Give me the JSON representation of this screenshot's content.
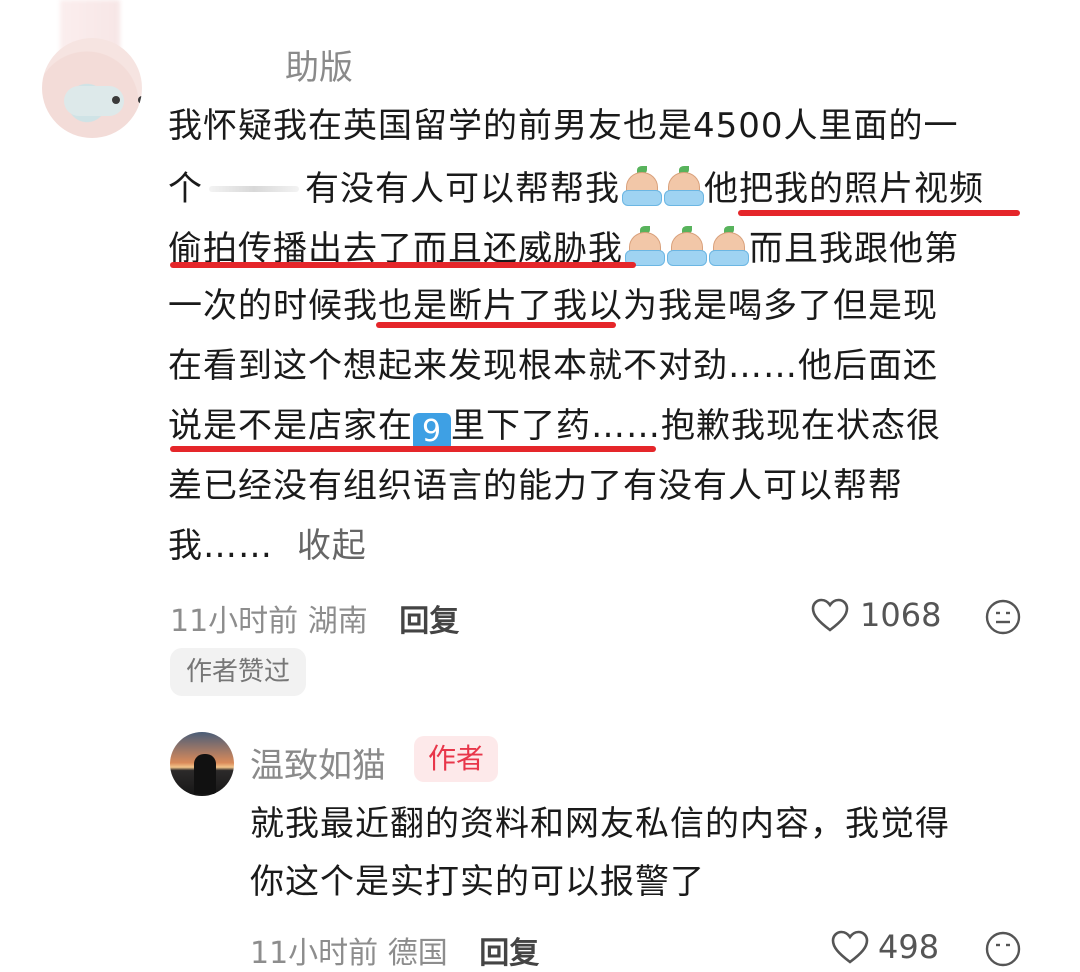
{
  "comment": {
    "username_visible": "助版",
    "lines": [
      "我怀疑我在英国留学的前男友也是4500人里面的一",
      "个",
      "有没有人可以帮帮我",
      "他把我的照片视频",
      "偷拍传播出去了而且还威胁我",
      "而且我跟他第",
      "一次的时候",
      "我也是断片了我",
      "以为我是喝多了但是现",
      "在看到这个想起来发现根本就不对劲……他后面还",
      "说是不是店家在",
      "里下了药……抱歉我现在状态很",
      "差已经没有组织语言的能力了有没有人可以帮帮",
      "我……"
    ],
    "nine_emoji": "9",
    "collapse_label": "收起",
    "time": "11小时前",
    "location": "湖南",
    "reply_label": "回复",
    "likes": "1068",
    "author_liked_badge": "作者赞过",
    "icons": [
      "heart-icon",
      "emoji-icon",
      "crying-emoji-icon"
    ],
    "highlight_color": "#e5262a"
  },
  "reply": {
    "username": "温致如猫",
    "author_badge": "作者",
    "line1": "就我最近翻的资料和网友私信的内容，我觉得",
    "line2": "你这个是实打实的可以报警了",
    "time": "11小时前",
    "location": "德国",
    "reply_label": "回复",
    "likes": "498"
  }
}
